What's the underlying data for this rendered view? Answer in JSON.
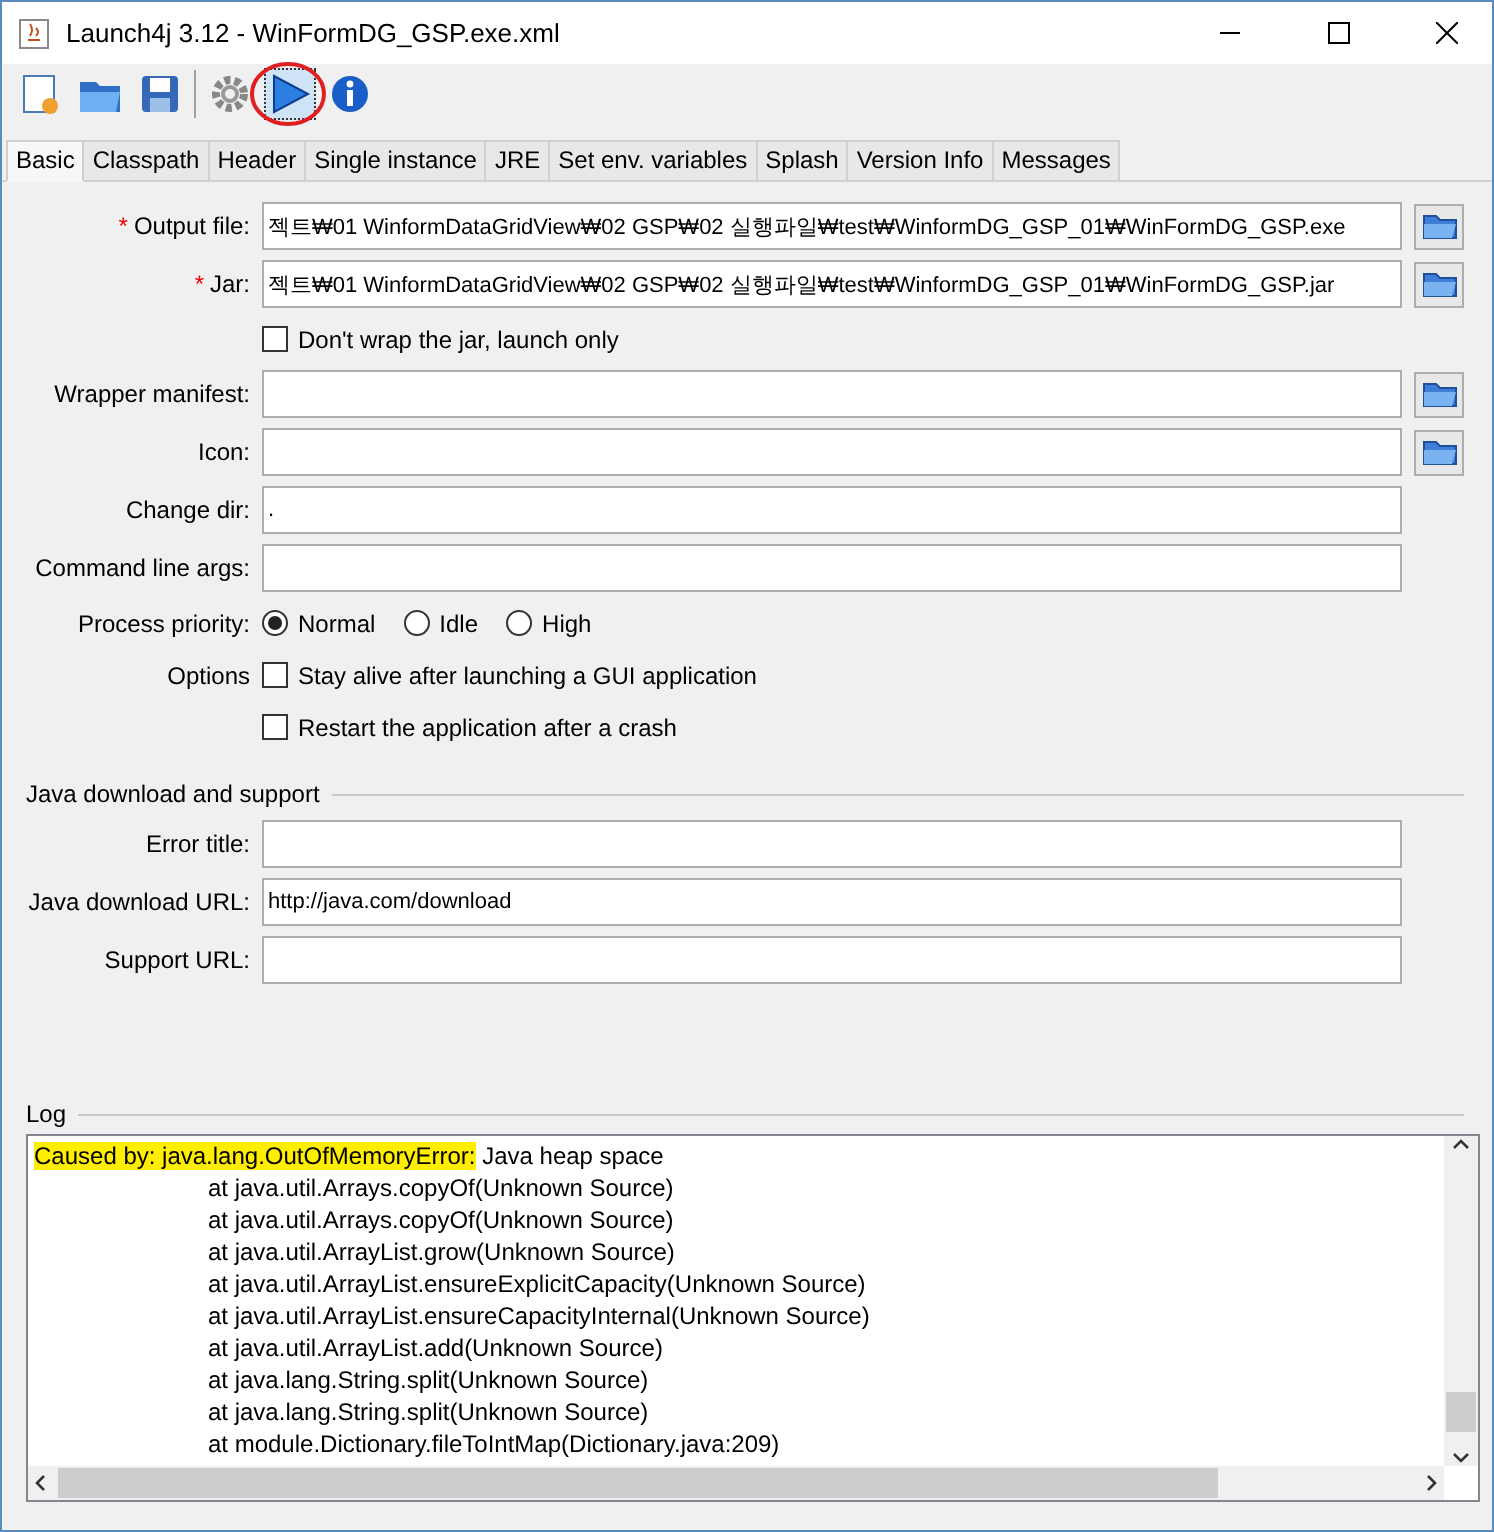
{
  "window": {
    "title": "Launch4j 3.12 - WinFormDG_GSP.exe.xml"
  },
  "toolbar": [
    {
      "kind": "new"
    },
    {
      "kind": "open"
    },
    {
      "kind": "save"
    },
    {
      "kind": "sep"
    },
    {
      "kind": "build"
    },
    {
      "kind": "run",
      "selected": true
    },
    {
      "kind": "info"
    }
  ],
  "tabs": [
    {
      "label": "Basic",
      "selected": true
    },
    {
      "label": "Classpath",
      "selected": false
    },
    {
      "label": "Header",
      "selected": false
    },
    {
      "label": "Single instance",
      "selected": false
    },
    {
      "label": "JRE",
      "selected": false
    },
    {
      "label": "Set env. variables",
      "selected": false
    },
    {
      "label": "Splash",
      "selected": false
    },
    {
      "label": "Version Info",
      "selected": false
    },
    {
      "label": "Messages",
      "selected": false
    }
  ],
  "form": [
    {
      "kind": "field",
      "marker": "*",
      "label": "Output file:",
      "value": "젝트₩01 WinformDataGridView₩02 GSP₩02 실행파일₩test₩WinformDG_GSP_01₩WinFormDG_GSP.exe",
      "browse": true
    },
    {
      "kind": "field",
      "marker": "*",
      "label": "Jar:",
      "value": "젝트₩01 WinformDataGridView₩02 GSP₩02 실행파일₩test₩WinformDG_GSP_01₩WinFormDG_GSP.jar",
      "browse": true
    },
    {
      "kind": "check",
      "text": "Don't wrap the jar, launch only",
      "checked": false
    },
    {
      "kind": "field",
      "label": "Wrapper manifest:",
      "browse": true
    },
    {
      "kind": "field",
      "label": "Icon:",
      "browse": true
    },
    {
      "kind": "field",
      "label": "Change dir:",
      "value": ".",
      "browse": false
    },
    {
      "kind": "field",
      "label": "Command line args:",
      "browse": false
    },
    {
      "kind": "radio",
      "label": "Process priority:",
      "options": [
        {
          "text": "Normal",
          "selected": true
        },
        {
          "text": "Idle",
          "selected": false
        },
        {
          "text": "High",
          "selected": false
        }
      ]
    },
    {
      "kind": "check",
      "label": "Options",
      "text": "Stay alive after launching a GUI application",
      "checked": false
    },
    {
      "kind": "check",
      "text": "Restart the application after a crash",
      "checked": false
    }
  ],
  "java_section": {
    "title": "Java download and support",
    "fields": [
      {
        "label": "Error title:"
      },
      {
        "label": "Java download URL:",
        "value": "http://java.com/download"
      },
      {
        "label": "Support URL:"
      }
    ]
  },
  "log": {
    "title": "Log",
    "lines": [
      {
        "marked": "Caused by: java.lang.OutOfMemoryError:",
        "text": " Java heap space",
        "indent": false
      },
      {
        "text": "at java.util.Arrays.copyOf(Unknown Source)",
        "indent": true
      },
      {
        "text": "at java.util.Arrays.copyOf(Unknown Source)",
        "indent": true
      },
      {
        "text": "at java.util.ArrayList.grow(Unknown Source)",
        "indent": true
      },
      {
        "text": "at java.util.ArrayList.ensureExplicitCapacity(Unknown Source)",
        "indent": true
      },
      {
        "text": "at java.util.ArrayList.ensureCapacityInternal(Unknown Source)",
        "indent": true
      },
      {
        "text": "at java.util.ArrayList.add(Unknown Source)",
        "indent": true
      },
      {
        "text": "at java.lang.String.split(Unknown Source)",
        "indent": true
      },
      {
        "text": "at java.lang.String.split(Unknown Source)",
        "indent": true
      },
      {
        "text": "at module.Dictionary.fileToIntMap(Dictionary.java:209)",
        "indent": true
      }
    ]
  }
}
